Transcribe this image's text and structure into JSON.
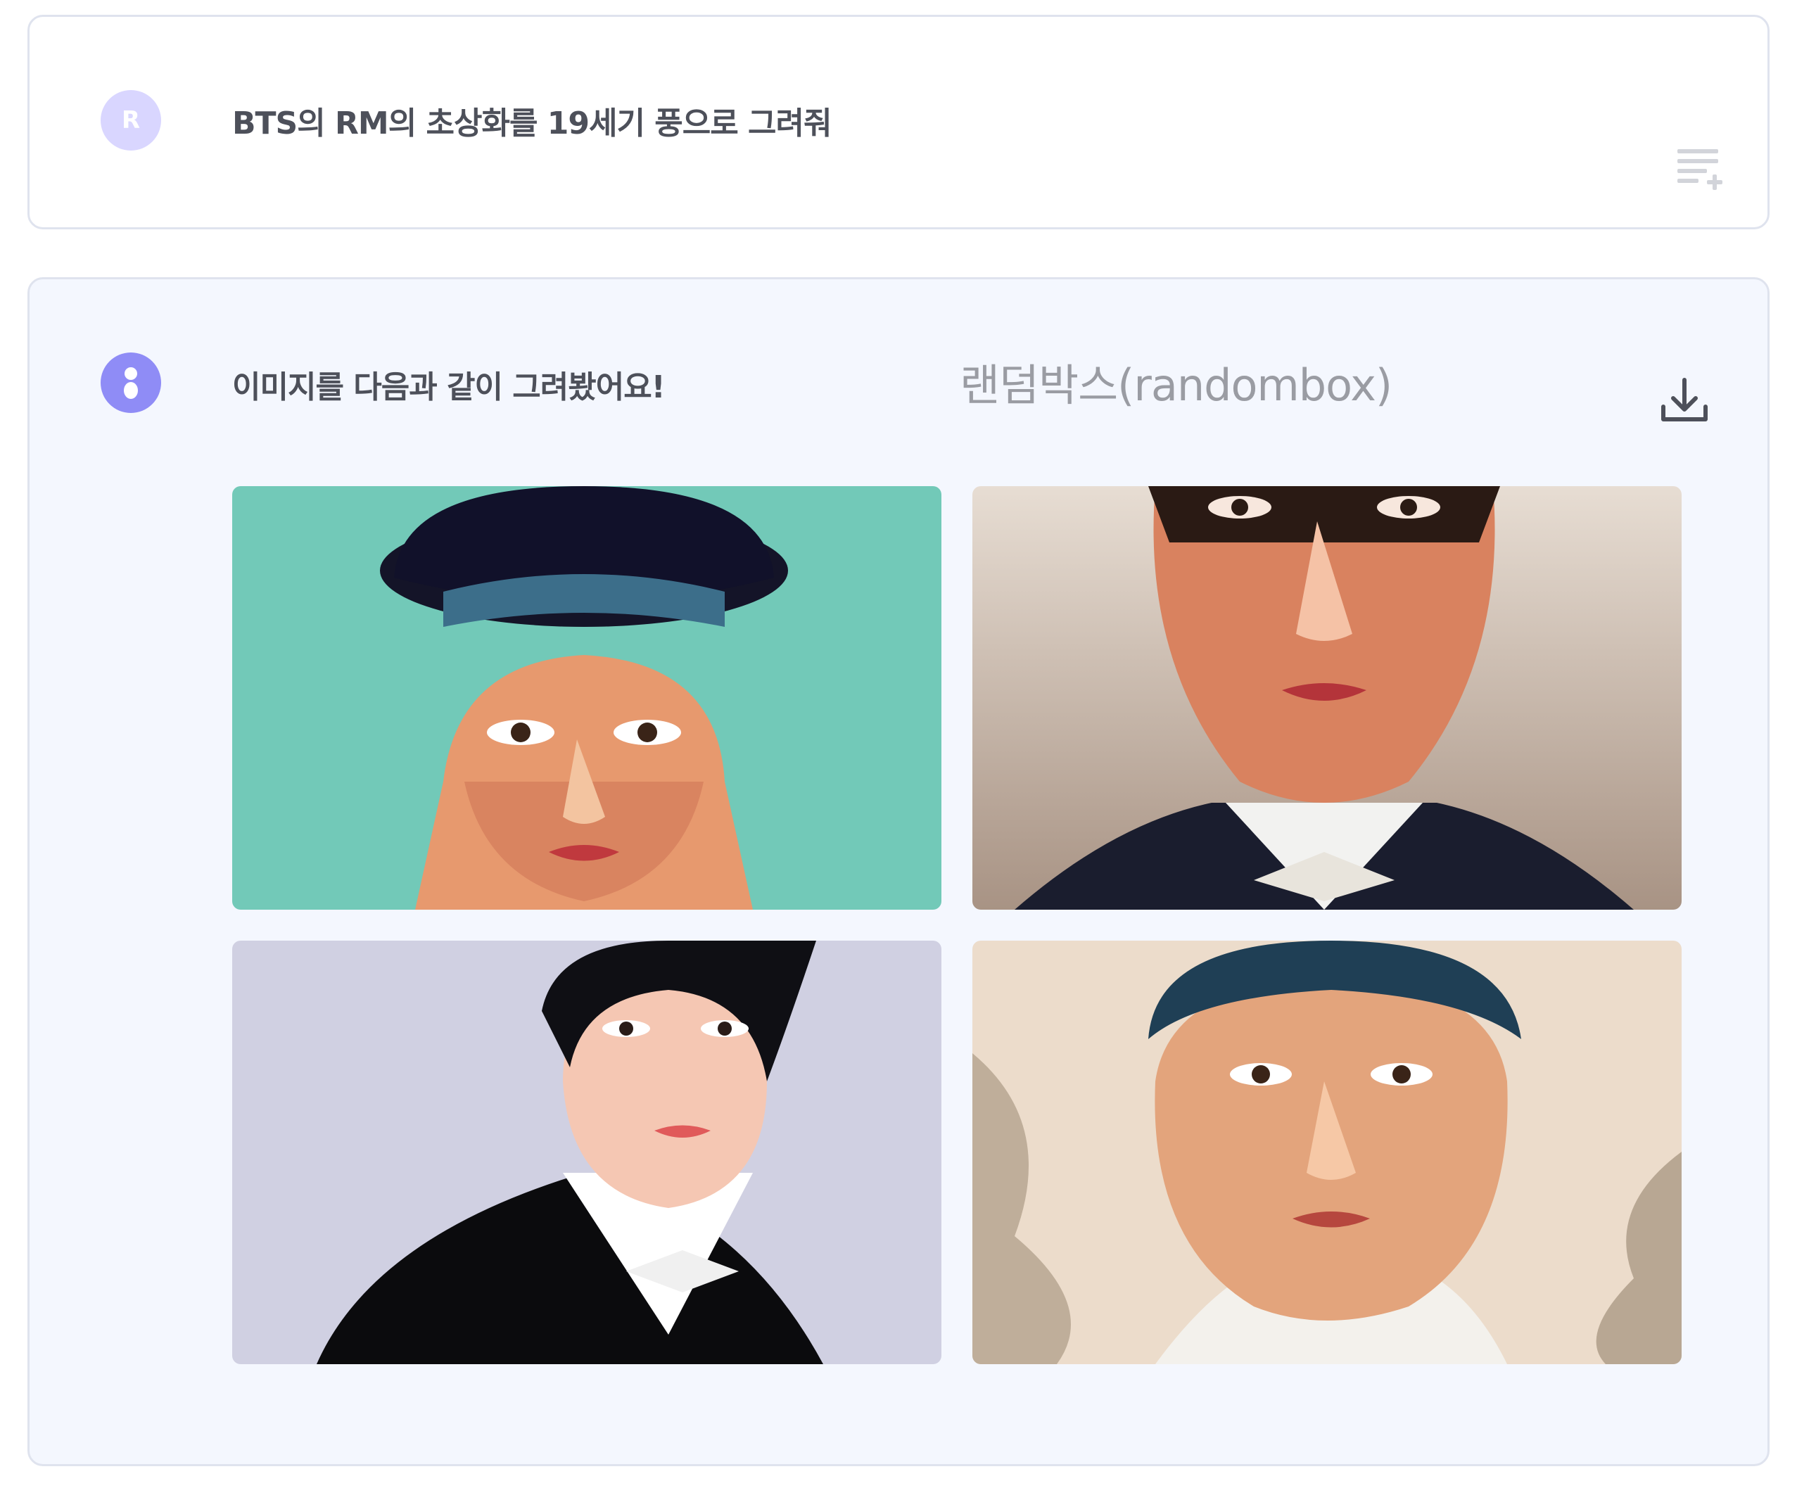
{
  "user_message": {
    "avatar_letter": "R",
    "text": "BTS의 RM의 초상화를 19세기 풍으로 그려줘",
    "action_icon": "add-to-queue-icon"
  },
  "bot_message": {
    "avatar_icon": "assistant-logo-icon",
    "text": "이미지를 다음과 같이 그려봤어요!",
    "watermark": "랜덤박스(randombox)",
    "action_icon": "download-icon",
    "images": [
      {
        "name": "portrait-1",
        "background": "#72c9b8"
      },
      {
        "name": "portrait-2",
        "background": "#c7b6a6"
      },
      {
        "name": "portrait-3",
        "background": "#d0d0e2"
      },
      {
        "name": "portrait-4",
        "background": "#ecdccb"
      }
    ]
  },
  "colors": {
    "accent": "#8f8cf6",
    "user_avatar": "#d9d6ff",
    "card_border": "#dfe3ee",
    "bot_card_bg": "#f4f7fe"
  }
}
